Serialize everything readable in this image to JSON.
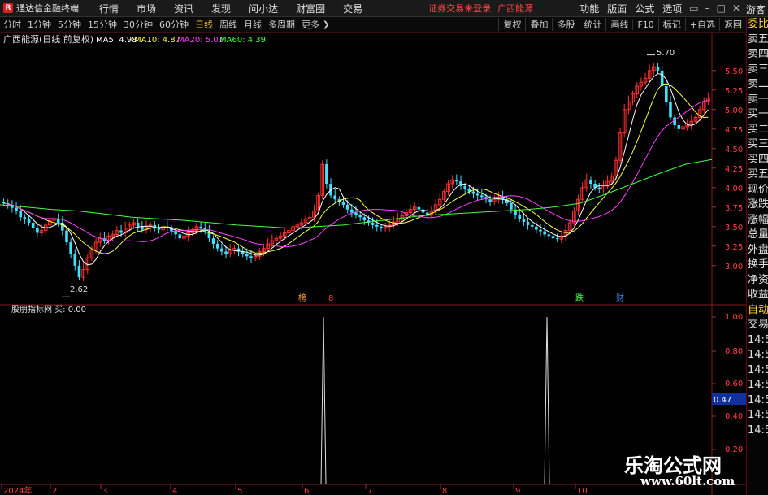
{
  "app": {
    "title": "通达信金融终端",
    "notice": "证券交易未登录",
    "stock_tab": "广西能源",
    "guest": "游客"
  },
  "menus": [
    "行情",
    "市场",
    "资讯",
    "发现",
    "问小达",
    "财富圈",
    "交易"
  ],
  "right_menus": [
    "功能",
    "版面",
    "公式",
    "选项"
  ],
  "window_controls": [
    "▭",
    "–",
    "□",
    "✕"
  ],
  "periods": [
    "分时",
    "1分钟",
    "5分钟",
    "15分钟",
    "30分钟",
    "60分钟",
    "日线",
    "周线",
    "月线",
    "多周期",
    "更多"
  ],
  "active_period": "日线",
  "toolbar_buttons": [
    "复权",
    "叠加",
    "多股",
    "统计",
    "画线",
    "F10",
    "标记",
    "+自选",
    "返回"
  ],
  "main_chart": {
    "stock_label": "广西能源(日线 前复权)",
    "ma": [
      {
        "label": "MA5: 4.98",
        "color": "#ffffff"
      },
      {
        "label": "MA10: 4.87",
        "color": "#ffff40"
      },
      {
        "label": "MA20: 5.01",
        "color": "#ff40ff"
      },
      {
        "label": "MA60: 4.39",
        "color": "#40ff40"
      }
    ],
    "price_axis": [
      "5.50",
      "5.25",
      "5.00",
      "4.75",
      "4.50",
      "4.25",
      "4.00",
      "3.75",
      "3.50",
      "3.25",
      "3.00"
    ],
    "high_label": "5.70",
    "low_label": "2.62",
    "markers": [
      {
        "text": "榜",
        "color": "#ffa040"
      },
      {
        "text": "8",
        "color": "#ff4040"
      },
      {
        "text": "跌",
        "color": "#40ff40"
      },
      {
        "text": "财",
        "color": "#4090ff"
      }
    ]
  },
  "indicator": {
    "label": "股朋指标网 买: 0.00",
    "axis": [
      "1.00",
      "0.80",
      "0.60",
      "0.47",
      "0.40",
      "0.20"
    ],
    "highlight": "0.47"
  },
  "date_axis": [
    "2024年",
    "2",
    "3",
    "4",
    "5",
    "6",
    "7",
    "8",
    "9",
    "10"
  ],
  "chart_data": {
    "type": "candlestick",
    "title": "广西能源(日线 前复权)",
    "ylim": [
      2.55,
      5.8
    ],
    "high": 5.7,
    "low": 2.62,
    "ma_latest": {
      "MA5": 4.98,
      "MA10": 4.87,
      "MA20": 5.01,
      "MA60": 4.39
    },
    "close": [
      3.8,
      3.78,
      3.74,
      3.7,
      3.62,
      3.6,
      3.55,
      3.48,
      3.42,
      3.45,
      3.52,
      3.58,
      3.6,
      3.55,
      3.45,
      3.3,
      3.15,
      3.0,
      2.85,
      2.95,
      3.1,
      3.2,
      3.3,
      3.35,
      3.32,
      3.38,
      3.4,
      3.45,
      3.42,
      3.48,
      3.52,
      3.55,
      3.5,
      3.46,
      3.5,
      3.52,
      3.48,
      3.46,
      3.5,
      3.48,
      3.44,
      3.4,
      3.35,
      3.38,
      3.42,
      3.45,
      3.5,
      3.48,
      3.44,
      3.35,
      3.28,
      3.22,
      3.18,
      3.15,
      3.2,
      3.22,
      3.18,
      3.15,
      3.12,
      3.1,
      3.12,
      3.18,
      3.22,
      3.28,
      3.32,
      3.35,
      3.38,
      3.42,
      3.45,
      3.5,
      3.52,
      3.55,
      3.6,
      3.62,
      3.7,
      3.9,
      4.3,
      4.05,
      3.9,
      3.85,
      3.82,
      3.78,
      3.72,
      3.68,
      3.65,
      3.62,
      3.58,
      3.55,
      3.52,
      3.5,
      3.48,
      3.5,
      3.52,
      3.56,
      3.6,
      3.64,
      3.68,
      3.72,
      3.75,
      3.72,
      3.68,
      3.65,
      3.7,
      3.78,
      3.85,
      3.95,
      4.05,
      4.1,
      4.08,
      4.02,
      3.98,
      3.95,
      3.92,
      3.9,
      3.88,
      3.85,
      3.82,
      3.85,
      3.88,
      3.85,
      3.8,
      3.72,
      3.65,
      3.6,
      3.56,
      3.52,
      3.5,
      3.46,
      3.44,
      3.4,
      3.38,
      3.35,
      3.34,
      3.38,
      3.45,
      3.55,
      3.7,
      3.85,
      4.0,
      4.1,
      4.05,
      4.0,
      3.98,
      4.02,
      4.08,
      4.15,
      4.35,
      4.7,
      5.0,
      5.1,
      5.2,
      5.3,
      5.35,
      5.4,
      5.5,
      5.55,
      5.5,
      5.3,
      5.1,
      4.9,
      4.8,
      4.75,
      4.78,
      4.8,
      4.85,
      4.9,
      5.0,
      5.1,
      5.15
    ],
    "ma60_approx": [
      3.78,
      3.75,
      3.72,
      3.7,
      3.66,
      3.62,
      3.6,
      3.58,
      3.55,
      3.52,
      3.5,
      3.48,
      3.5,
      3.52,
      3.56,
      3.6,
      3.64,
      3.66,
      3.68,
      3.7,
      3.72,
      3.75,
      3.8,
      3.92,
      4.05,
      4.18,
      4.3,
      4.36
    ],
    "buy_signal": {
      "values": [
        0,
        1.0,
        0,
        1.0,
        0
      ],
      "ylim": [
        0,
        1.0
      ]
    }
  }
}
